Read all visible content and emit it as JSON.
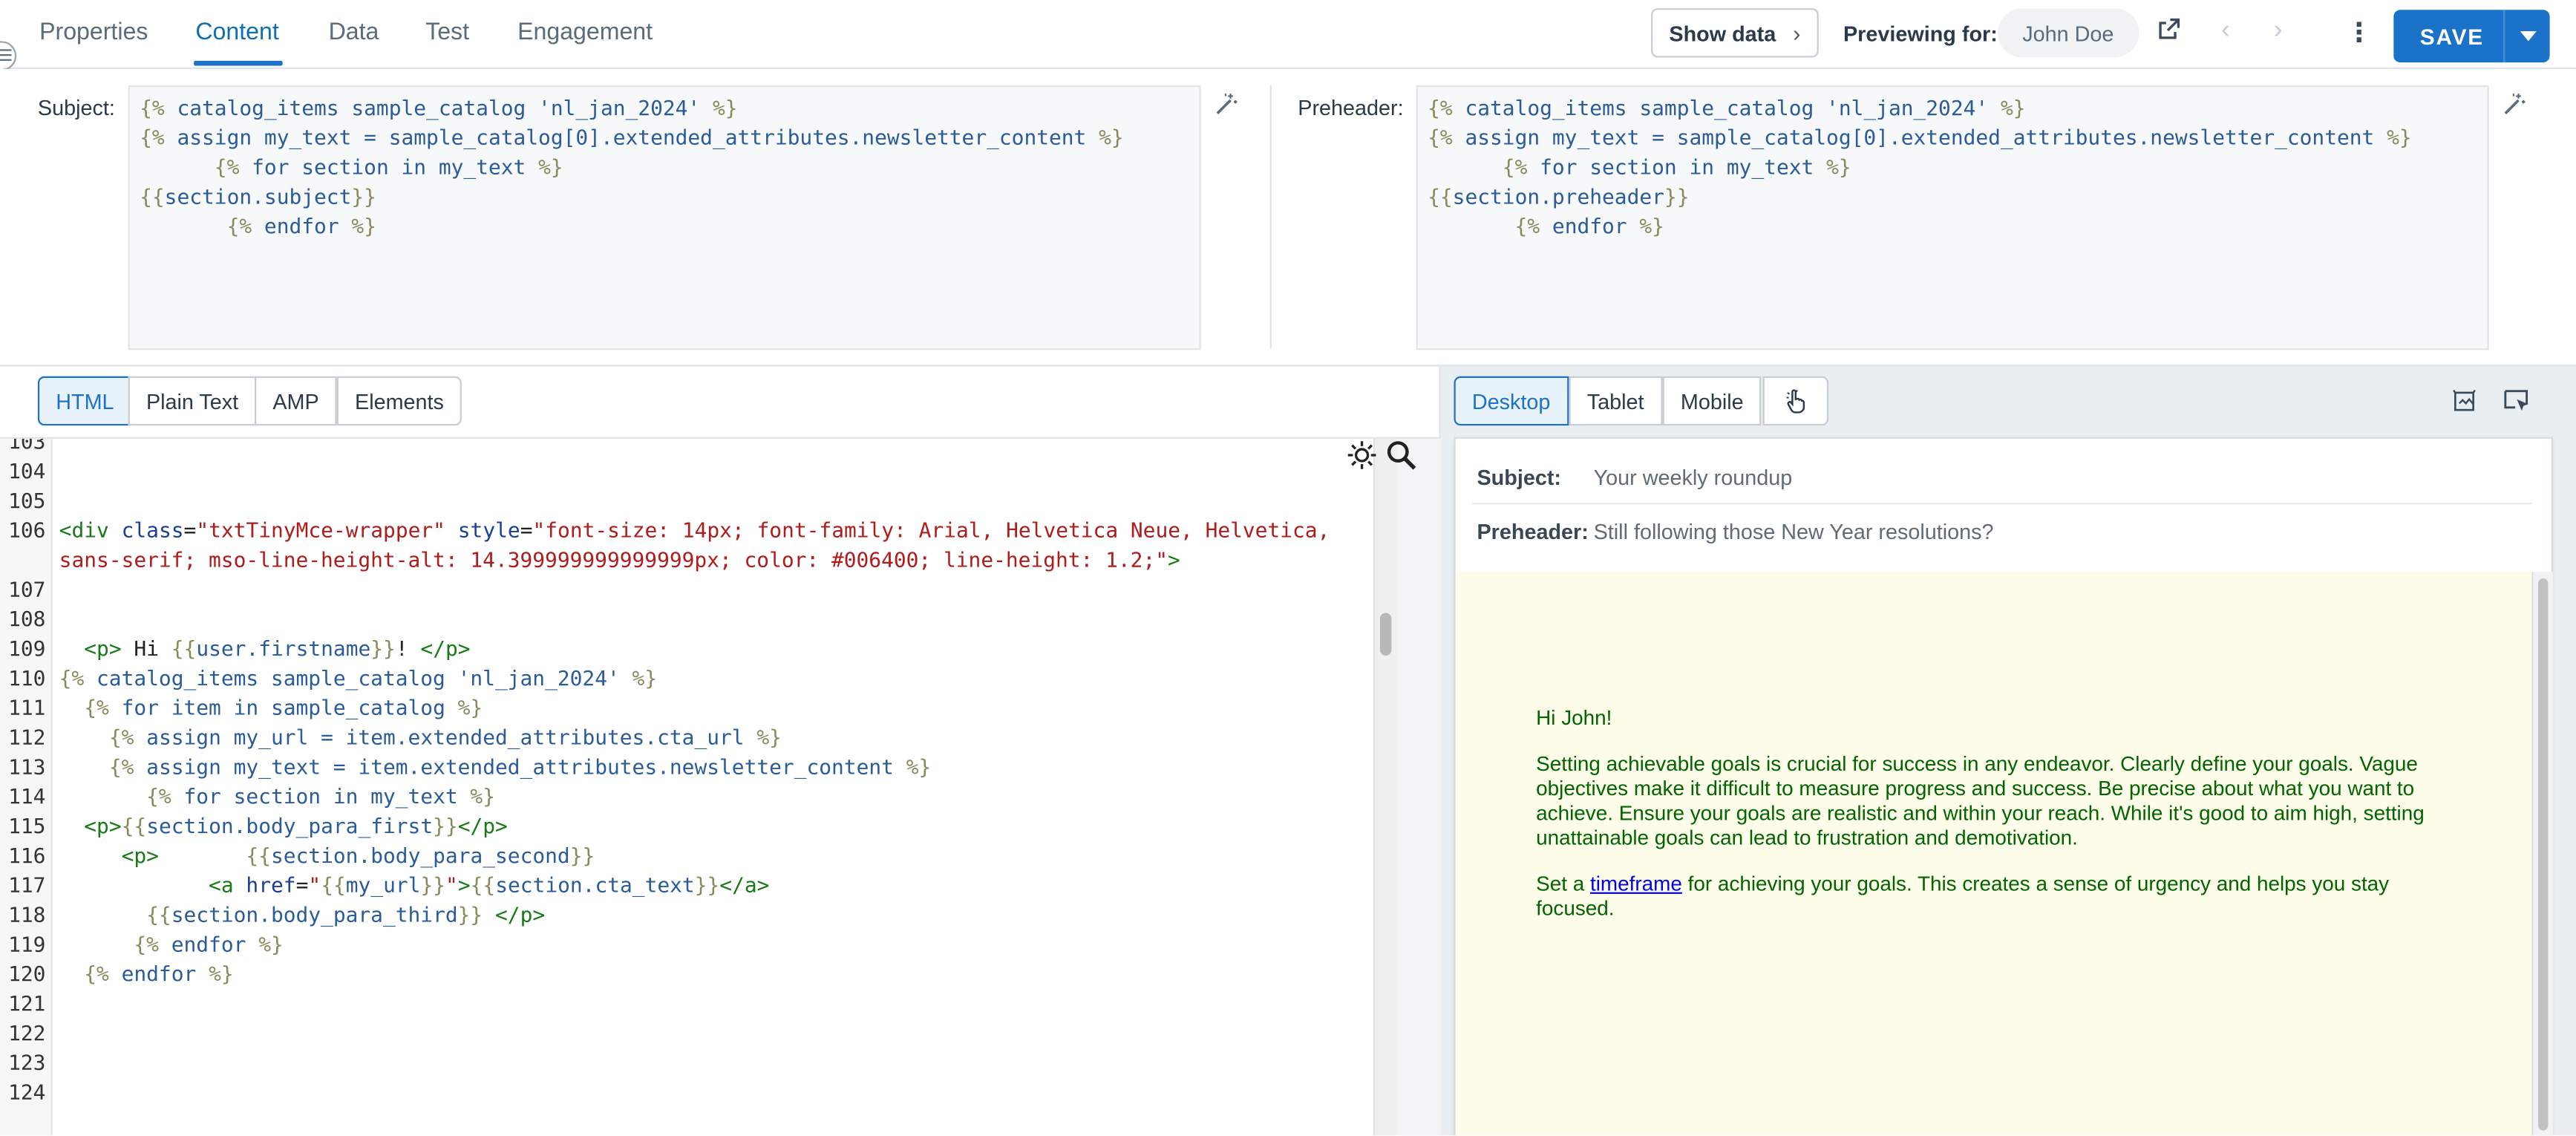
{
  "nav": {
    "tabs": [
      "Properties",
      "Content",
      "Data",
      "Test",
      "Engagement"
    ],
    "active_tab": "Content",
    "show_data_label": "Show data",
    "previewing_label": "Previewing for:",
    "preview_user": "John Doe",
    "save_label": "SAVE"
  },
  "subject": {
    "label": "Subject:",
    "code": [
      "{% catalog_items sample_catalog 'nl_jan_2024' %}",
      "{% assign my_text = sample_catalog[0].extended_attributes.newsletter_content %}",
      "      {% for section in my_text %}",
      "{{section.subject}}",
      "       {% endfor %}"
    ]
  },
  "preheader": {
    "label": "Preheader:",
    "code": [
      "{% catalog_items sample_catalog 'nl_jan_2024' %}",
      "{% assign my_text = sample_catalog[0].extended_attributes.newsletter_content %}",
      "      {% for section in my_text %}",
      "{{section.preheader}}",
      "       {% endfor %}"
    ]
  },
  "editor": {
    "modes": [
      "HTML",
      "Plain Text",
      "AMP",
      "Elements"
    ],
    "active_mode": "HTML",
    "lines": [
      {
        "n": "103",
        "t": ""
      },
      {
        "n": "104",
        "t": ""
      },
      {
        "n": "105",
        "t": ""
      },
      {
        "n": "106",
        "t": "<div class=\"txtTinyMce-wrapper\" style=\"font-size: 14px; font-family: Arial, Helvetica Neue, Helvetica,"
      },
      {
        "n": "",
        "t": "sans-serif; mso-line-height-alt: 14.399999999999999px; color: #006400; line-height: 1.2;\">"
      },
      {
        "n": "107",
        "t": ""
      },
      {
        "n": "108",
        "t": ""
      },
      {
        "n": "109",
        "t": "  <p> Hi {{user.firstname}}! </p>"
      },
      {
        "n": "110",
        "t": "{% catalog_items sample_catalog 'nl_jan_2024' %}"
      },
      {
        "n": "111",
        "t": "  {% for item in sample_catalog %}"
      },
      {
        "n": "112",
        "t": "    {% assign my_url = item.extended_attributes.cta_url %}"
      },
      {
        "n": "113",
        "t": "    {% assign my_text = item.extended_attributes.newsletter_content %}"
      },
      {
        "n": "114",
        "t": "       {% for section in my_text %}"
      },
      {
        "n": "115",
        "t": "  <p>{{section.body_para_first}}</p>"
      },
      {
        "n": "116",
        "t": "     <p>       {{section.body_para_second}}"
      },
      {
        "n": "117",
        "t": "            <a href=\"{{my_url}}\">{{section.cta_text}}</a>"
      },
      {
        "n": "118",
        "t": "       {{section.body_para_third}} </p>"
      },
      {
        "n": "119",
        "t": "      {% endfor %}"
      },
      {
        "n": "120",
        "t": "  {% endfor %}"
      },
      {
        "n": "121",
        "t": ""
      },
      {
        "n": "122",
        "t": ""
      },
      {
        "n": "123",
        "t": ""
      },
      {
        "n": "124",
        "t": ""
      }
    ]
  },
  "preview": {
    "devices": [
      "Desktop",
      "Tablet",
      "Mobile"
    ],
    "active_device": "Desktop",
    "subject_label": "Subject:",
    "subject_value": "Your weekly roundup",
    "preheader_label": "Preheader:",
    "preheader_value": "Still following those New Year resolutions?",
    "greeting": "Hi John!",
    "para1": "Setting achievable goals is crucial for success in any endeavor. Clearly define your goals. Vague objectives make it difficult to measure progress and success. Be precise about what you want to achieve. Ensure your goals are realistic and within your reach. While it's good to aim high, setting unattainable goals can lead to frustration and demotivation.",
    "para2_before": "Set a ",
    "para2_link": "timeframe",
    "para2_after": " for achieving your goals. This creates a sense of urgency and helps you stay focused.",
    "text_color": "#006400",
    "link_color": "#0000ee",
    "background_color": "#fdfde9"
  },
  "icons": {
    "subject_wand": "magic-wand-icon",
    "preheader_wand": "magic-wand-icon",
    "theme_toggle": "sun-icon",
    "search": "search-icon",
    "external_link": "external-link-icon",
    "pointer": "pointer-hand-icon",
    "image_off": "image-off-icon",
    "inspect": "cursor-box-icon"
  },
  "colors": {
    "accent": "#1a73c8",
    "tag": "#177a17",
    "attr": "#1a3f9a",
    "string": "#b01c1c"
  }
}
